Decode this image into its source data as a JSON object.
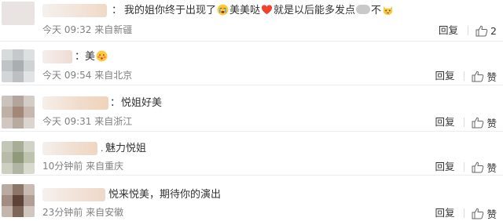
{
  "comments": [
    {
      "separator": "：",
      "text_a": "我的姐你终于出现了",
      "icon_a": "crying-face-emoji",
      "text_b": "美美哒",
      "icon_b": "red-heart-emoji",
      "text_c": "就是以后能多发点",
      "text_d": "不",
      "icon_c": "cat-face-emoji",
      "time": "今天 09:32",
      "location": "来自新疆",
      "reply_label": "回复",
      "like_count": "2"
    },
    {
      "separator": "：",
      "text_a": "美",
      "icon_a": "blushing-face-emoji",
      "time": "今天 09:54",
      "location": "来自北京",
      "reply_label": "回复",
      "like_label": "赞"
    },
    {
      "separator": "：",
      "text_a": "悦姐好美",
      "time": "今天 09:31",
      "location": "来自浙江",
      "reply_label": "回复",
      "like_label": "赞"
    },
    {
      "separator": "：",
      "text_a": "魅力悦姐",
      "time": "10分钟前",
      "location": "来自重庆",
      "reply_label": "回复",
      "like_label": "赞"
    },
    {
      "separator": "：",
      "text_a": "悦来悦美，期待你的演出",
      "time": "23分钟前",
      "location": "来自安徽",
      "reply_label": "回复",
      "like_label": "赞"
    }
  ],
  "colors": {
    "text": "#333333",
    "meta": "#808080",
    "divider": "#ececec"
  }
}
